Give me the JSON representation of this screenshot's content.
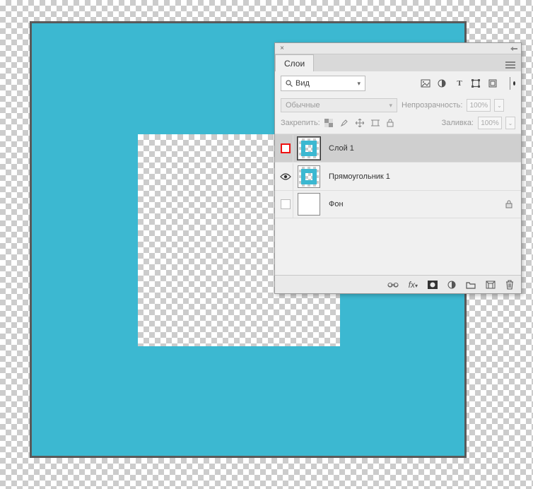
{
  "panel": {
    "tab_label": "Слои",
    "filter": {
      "search_label": "Вид"
    },
    "blend": {
      "mode_label": "Обычные",
      "opacity_label": "Непрозрачность:",
      "opacity_value": "100%"
    },
    "lock": {
      "label": "Закрепить:",
      "fill_label": "Заливка:",
      "fill_value": "100%"
    },
    "layers": [
      {
        "name": "Слой 1",
        "visible_box": "red-empty",
        "selected": true,
        "thumb": "cyan-hole",
        "locked": false
      },
      {
        "name": "Прямоугольник 1",
        "visible_box": "eye",
        "selected": false,
        "thumb": "cyan-hole",
        "locked": false
      },
      {
        "name": "Фон",
        "visible_box": "empty",
        "selected": false,
        "thumb": "white",
        "locked": true
      }
    ]
  }
}
